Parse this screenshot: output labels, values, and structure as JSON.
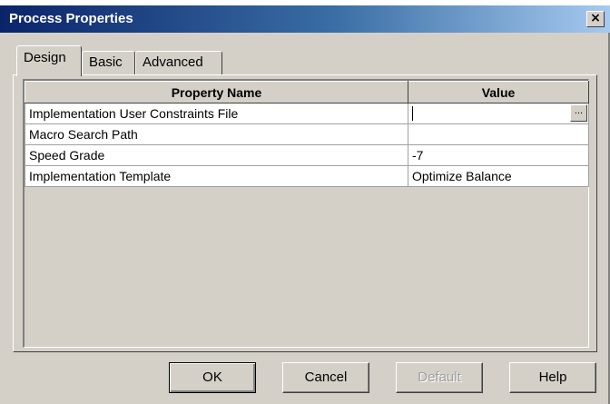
{
  "window": {
    "title": "Process Properties",
    "close_glyph": "×"
  },
  "tabs": [
    {
      "label": "Design",
      "active": true
    },
    {
      "label": "Basic",
      "active": false
    },
    {
      "label": "Advanced",
      "active": false
    }
  ],
  "table": {
    "headers": [
      "Property Name",
      "Value"
    ],
    "rows": [
      {
        "name": "Implementation User Constraints File",
        "value": "",
        "browse_label": "..."
      },
      {
        "name": "Macro Search Path",
        "value": ""
      },
      {
        "name": "Speed Grade",
        "value": "-7"
      },
      {
        "name": "Implementation Template",
        "value": "Optimize Balance"
      }
    ]
  },
  "buttons": {
    "ok": "OK",
    "cancel": "Cancel",
    "default": "Default",
    "help": "Help"
  }
}
